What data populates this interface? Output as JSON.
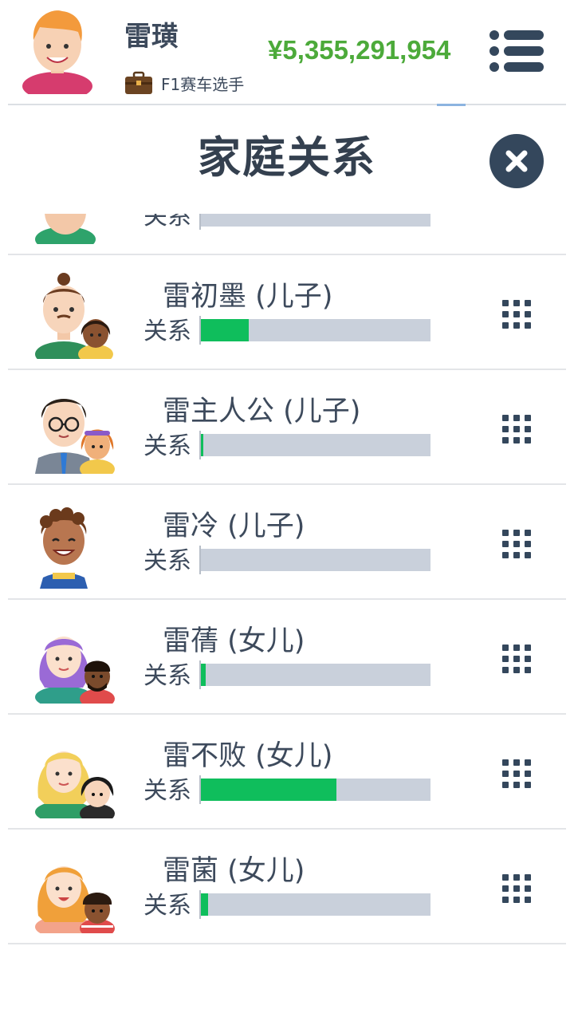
{
  "header": {
    "player_name": "雷璜",
    "job_title": "F1赛车选手",
    "money": "¥5,355,291,954"
  },
  "panel": {
    "title": "家庭关系"
  },
  "relation_label": "关系",
  "children": [
    {
      "name": "",
      "relationship": 0.0,
      "partial": true
    },
    {
      "name": "雷初墨 (儿子)",
      "relationship": 0.21
    },
    {
      "name": "雷主人公 (儿子)",
      "relationship": 0.01
    },
    {
      "name": "雷冷 (儿子)",
      "relationship": 0.0
    },
    {
      "name": "雷蒨 (女儿)",
      "relationship": 0.02
    },
    {
      "name": "雷不败 (女儿)",
      "relationship": 0.59
    },
    {
      "name": "雷菌 (女儿)",
      "relationship": 0.03
    }
  ],
  "colors": {
    "money": "#4caa3a",
    "bar_fill": "#0fbe5c",
    "bar_track": "#c9d0db",
    "text": "#3d4a5c",
    "dark_button": "#34475c"
  },
  "icons": {
    "menu": "list-menu-icon",
    "close": "close-icon",
    "job": "briefcase-icon",
    "more": "grid-dots-icon"
  }
}
